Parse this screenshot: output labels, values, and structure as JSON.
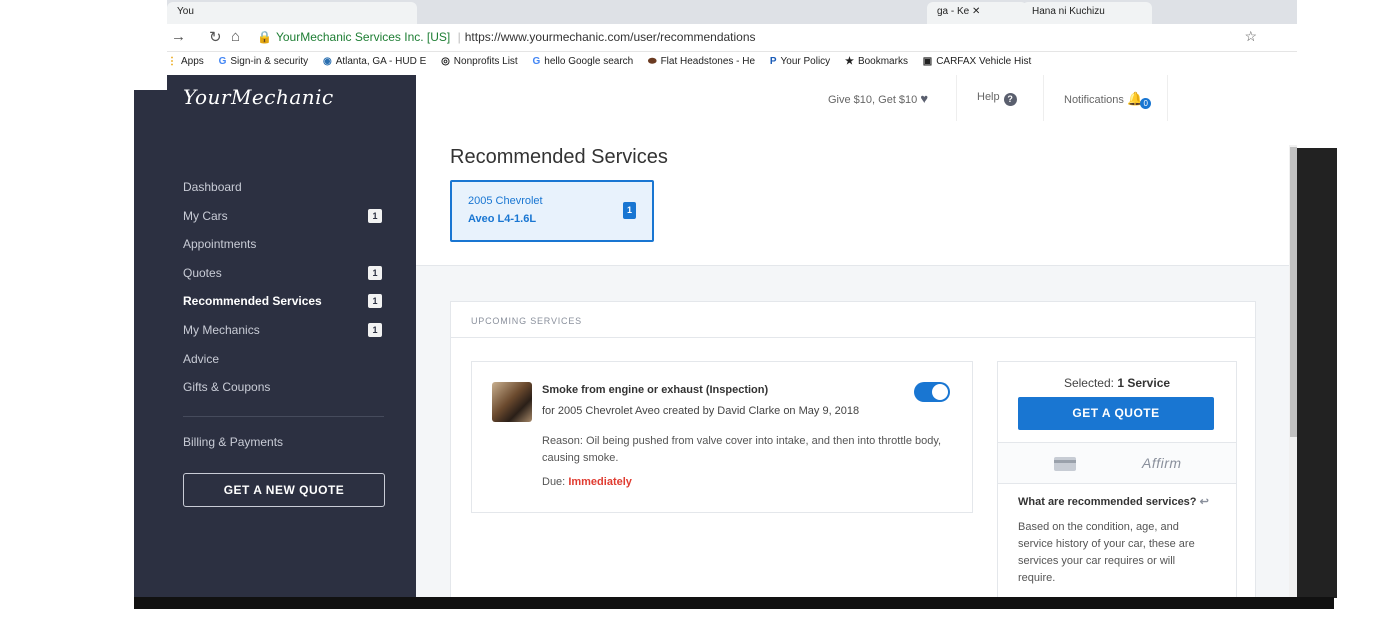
{
  "browser": {
    "tabs": [
      {
        "label": "You"
      },
      {
        "label": "ga - Ke"
      },
      {
        "label": "Hana ni Kuchizu"
      }
    ],
    "url_org": "YourMechanic Services Inc. [US]",
    "url_path": "https://www.yourmechanic.com/user/recommendations",
    "bookmarks": [
      {
        "icon": "apps-icon",
        "label": "Apps"
      },
      {
        "icon": "google-icon",
        "label": "Sign-in & security"
      },
      {
        "icon": "hud-icon",
        "label": "Atlanta, GA - HUD E"
      },
      {
        "icon": "nonprofit-icon",
        "label": "Nonprofits List"
      },
      {
        "icon": "google-icon",
        "label": "hello Google search"
      },
      {
        "icon": "headstone-icon",
        "label": "Flat Headstones - He"
      },
      {
        "icon": "progressive-icon",
        "label": "Your Policy"
      },
      {
        "icon": "star-icon",
        "label": "Bookmarks"
      },
      {
        "icon": "carfax-icon",
        "label": "CARFAX Vehicle Hist"
      }
    ]
  },
  "sidebar": {
    "logo": "YourMechanic",
    "items": [
      {
        "label": "Dashboard",
        "badge": ""
      },
      {
        "label": "My Cars",
        "badge": "1"
      },
      {
        "label": "Appointments",
        "badge": ""
      },
      {
        "label": "Quotes",
        "badge": "1"
      },
      {
        "label": "Recommended Services",
        "badge": "1"
      },
      {
        "label": "My Mechanics",
        "badge": "1"
      },
      {
        "label": "Advice",
        "badge": ""
      },
      {
        "label": "Gifts & Coupons",
        "badge": ""
      }
    ],
    "billing": "Billing & Payments",
    "new_quote": "GET A NEW QUOTE"
  },
  "topnav": {
    "give": "Give $10, Get $10",
    "help": "Help",
    "notifications": "Notifications",
    "notifications_count": "0"
  },
  "page": {
    "title": "Recommended Services",
    "car": {
      "year_make": "2005 Chevrolet",
      "model": "Aveo L4-1.6L",
      "count": "1"
    }
  },
  "upcoming": {
    "header": "UPCOMING SERVICES",
    "service": {
      "title": "Smoke from engine or exhaust (Inspection)",
      "subtitle": "for 2005 Chevrolet Aveo created by David Clarke on May 9, 2018",
      "reason": "Reason: Oil being pushed from valve cover into intake, and then into throttle body, causing smoke.",
      "due_label": "Due:",
      "due_value": "Immediately",
      "selected": true
    }
  },
  "quote": {
    "selected_label": "Selected:",
    "selected_value": "1 Service",
    "button": "GET A QUOTE",
    "affirm": "Affirm",
    "what_title": "What are recommended services?",
    "what_body": "Based on the condition, age, and service history of your car, these are services your car requires or will require."
  },
  "colors": {
    "accent": "#1976d2",
    "sidebar": "#2c3041",
    "due": "#e03c31"
  }
}
